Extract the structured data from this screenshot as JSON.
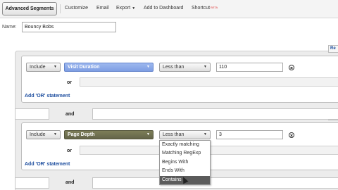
{
  "toolbar": {
    "advanced_segments": "Advanced Segments",
    "customize": "Customize",
    "email": "Email",
    "export": "Export",
    "add_to_dashboard": "Add to Dashboard",
    "shortcut": "Shortcut",
    "beta": "BETA"
  },
  "name": {
    "label": "Name:",
    "value": "Bouncy Bobs"
  },
  "remove_label": "Re",
  "condition1": {
    "include": "Include",
    "metric": "Visit Duration",
    "operator": "Less than",
    "value": "110",
    "or_label": "or",
    "add_or": "Add 'OR' statement"
  },
  "and_label": "and",
  "condition2": {
    "include": "Include",
    "metric": "Page Depth",
    "operator": "Less than",
    "value": "3",
    "or_label": "or",
    "add_or": "Add 'OR' statement"
  },
  "operator_menu": {
    "items": [
      "Exactly matching",
      "Matching RegExp",
      "Begins With",
      "Ends With",
      "Contains"
    ],
    "selected_index": 4
  },
  "colors": {
    "metric_blue": "#7e9ee3",
    "metric_olive": "#64654a",
    "link": "#1a4b9d"
  }
}
